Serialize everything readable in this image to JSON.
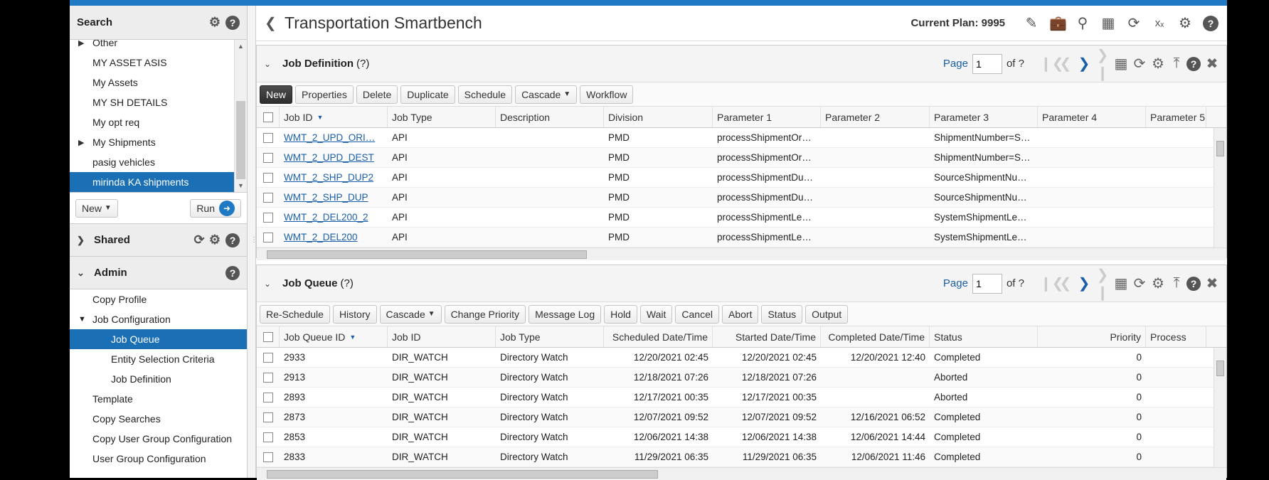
{
  "left": {
    "search_title": "Search",
    "tree": [
      {
        "label": "Other",
        "expandable": true
      },
      {
        "label": "MY ASSET ASIS"
      },
      {
        "label": "My Assets"
      },
      {
        "label": "MY SH DETAILS"
      },
      {
        "label": "My opt req"
      },
      {
        "label": "My Shipments",
        "expandable": true
      },
      {
        "label": "pasig vehicles"
      },
      {
        "label": "mirinda KA shipments",
        "selected": true
      }
    ],
    "new_label": "New",
    "run_label": "Run",
    "shared_title": "Shared",
    "admin_title": "Admin",
    "admin_items": {
      "copy_profile": "Copy Profile",
      "job_configuration": "Job Configuration",
      "job_queue": "Job Queue",
      "entity_selection": "Entity Selection Criteria",
      "job_definition": "Job Definition",
      "template": "Template",
      "copy_searches": "Copy Searches",
      "copy_user_group": "Copy User Group Configuration",
      "user_group": "User Group Configuration"
    }
  },
  "header": {
    "title": "Transportation Smartbench",
    "current_plan": "Current Plan: 9995"
  },
  "job_definition": {
    "title": "Job Definition",
    "help": "(?)",
    "page_label": "Page",
    "page_value": "1",
    "of_label": "of ?",
    "buttons": [
      "New",
      "Properties",
      "Delete",
      "Duplicate",
      "Schedule",
      "Cascade",
      "Workflow"
    ],
    "columns": [
      "Job ID",
      "Job Type",
      "Description",
      "Division",
      "Parameter 1",
      "Parameter 2",
      "Parameter 3",
      "Parameter 4",
      "Parameter 5"
    ],
    "rows": [
      [
        "WMT_2_UPD_ORI…",
        "API",
        "",
        "PMD",
        "processShipmentOr…",
        "",
        "ShipmentNumber=S…",
        ""
      ],
      [
        "WMT_2_UPD_DEST",
        "API",
        "",
        "PMD",
        "processShipmentOr…",
        "",
        "ShipmentNumber=S…",
        ""
      ],
      [
        "WMT_2_SHP_DUP2",
        "API",
        "",
        "PMD",
        "processShipmentDu…",
        "",
        "SourceShipmentNu…",
        ""
      ],
      [
        "WMT_2_SHP_DUP",
        "API",
        "",
        "PMD",
        "processShipmentDu…",
        "",
        "SourceShipmentNu…",
        ""
      ],
      [
        "WMT_2_DEL200_2",
        "API",
        "",
        "PMD",
        "processShipmentLe…",
        "",
        "SystemShipmentLe…",
        ""
      ],
      [
        "WMT_2_DEL200",
        "API",
        "",
        "PMD",
        "processShipmentLe…",
        "",
        "SystemShipmentLe…",
        ""
      ]
    ]
  },
  "job_queue": {
    "title": "Job Queue",
    "help": "(?)",
    "page_label": "Page",
    "page_value": "1",
    "of_label": "of ?",
    "buttons": [
      "Re-Schedule",
      "History",
      "Cascade",
      "Change Priority",
      "Message Log",
      "Hold",
      "Wait",
      "Cancel",
      "Abort",
      "Status",
      "Output"
    ],
    "columns": [
      "Job Queue ID",
      "Job ID",
      "Job Type",
      "Scheduled Date/Time",
      "Started Date/Time",
      "Completed Date/Time",
      "Status",
      "Priority",
      "Process"
    ],
    "rows": [
      [
        "2933",
        "DIR_WATCH",
        "Directory Watch",
        "12/20/2021 02:45",
        "12/20/2021 02:45",
        "12/20/2021 12:40",
        "Completed",
        "0"
      ],
      [
        "2913",
        "DIR_WATCH",
        "Directory Watch",
        "12/18/2021 07:26",
        "12/18/2021 07:26",
        "",
        "Aborted",
        "0"
      ],
      [
        "2893",
        "DIR_WATCH",
        "Directory Watch",
        "12/17/2021 00:35",
        "12/17/2021 00:35",
        "",
        "Aborted",
        "0"
      ],
      [
        "2873",
        "DIR_WATCH",
        "Directory Watch",
        "12/07/2021 09:52",
        "12/07/2021 09:52",
        "12/16/2021 06:52",
        "Completed",
        "0"
      ],
      [
        "2853",
        "DIR_WATCH",
        "Directory Watch",
        "12/06/2021 14:38",
        "12/06/2021 14:38",
        "12/06/2021 14:44",
        "Completed",
        "0"
      ],
      [
        "2833",
        "DIR_WATCH",
        "Directory Watch",
        "11/29/2021 06:35",
        "11/29/2021 06:35",
        "12/06/2021 11:46",
        "Completed",
        "0"
      ]
    ]
  }
}
